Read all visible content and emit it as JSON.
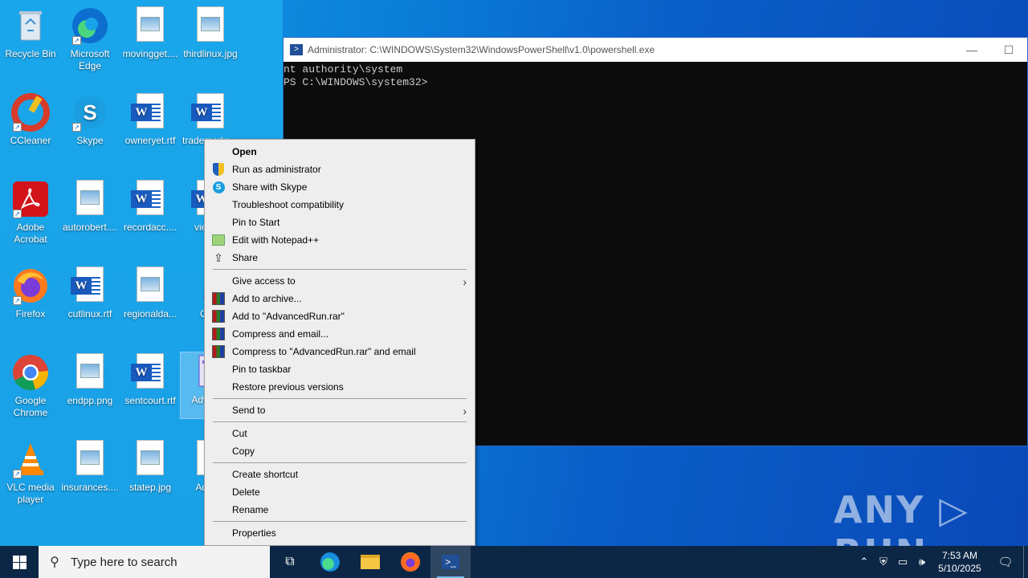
{
  "desktop": {
    "icons": [
      {
        "label": "Recycle Bin"
      },
      {
        "label": "Microsoft Edge"
      },
      {
        "label": "movingget...."
      },
      {
        "label": "thirdlinux.jpg"
      },
      {
        "label": "CCleaner"
      },
      {
        "label": "Skype"
      },
      {
        "label": "owneryet.rtf"
      },
      {
        "label": "trademarks..."
      },
      {
        "label": "Adobe Acrobat"
      },
      {
        "label": "autorobert...."
      },
      {
        "label": "recordacc...."
      },
      {
        "label": "views..."
      },
      {
        "label": "Firefox"
      },
      {
        "label": "cutlinux.rtf"
      },
      {
        "label": "regionalda..."
      },
      {
        "label": "Oh..."
      },
      {
        "label": "Google Chrome"
      },
      {
        "label": "endpp.png"
      },
      {
        "label": "sentcourt.rtf"
      },
      {
        "label": "Adva... n"
      },
      {
        "label": "VLC media player"
      },
      {
        "label": "insurances...."
      },
      {
        "label": "statep.jpg"
      },
      {
        "label": "Adva..."
      }
    ]
  },
  "powershell": {
    "title": "Administrator: C:\\WINDOWS\\System32\\WindowsPowerShell\\v1.0\\powershell.exe",
    "lines": [
      "nt authority\\system",
      "PS C:\\WINDOWS\\system32>"
    ],
    "minimize": "—",
    "maximize": "☐"
  },
  "context_menu": {
    "items": [
      {
        "label": "Open",
        "icon": ""
      },
      {
        "label": "Run as administrator",
        "icon": "shield-icon"
      },
      {
        "label": "Share with Skype",
        "icon": "skype-icon"
      },
      {
        "label": "Troubleshoot compatibility",
        "icon": ""
      },
      {
        "label": "Pin to Start",
        "icon": ""
      },
      {
        "label": "Edit with Notepad++",
        "icon": "notepadpp-icon"
      },
      {
        "label": "Share",
        "icon": "share-icon"
      },
      {
        "label": "Give access to",
        "icon": "",
        "submenu": true
      },
      {
        "label": "Add to archive...",
        "icon": "winrar-icon"
      },
      {
        "label": "Add to \"AdvancedRun.rar\"",
        "icon": "winrar-icon"
      },
      {
        "label": "Compress and email...",
        "icon": "winrar-icon"
      },
      {
        "label": "Compress to \"AdvancedRun.rar\" and email",
        "icon": "winrar-icon"
      },
      {
        "label": "Pin to taskbar",
        "icon": ""
      },
      {
        "label": "Restore previous versions",
        "icon": ""
      },
      {
        "label": "Send to",
        "icon": "",
        "submenu": true
      },
      {
        "label": "Cut",
        "icon": ""
      },
      {
        "label": "Copy",
        "icon": ""
      },
      {
        "label": "Create shortcut",
        "icon": ""
      },
      {
        "label": "Delete",
        "icon": ""
      },
      {
        "label": "Rename",
        "icon": ""
      },
      {
        "label": "Properties",
        "icon": ""
      }
    ]
  },
  "taskbar": {
    "search_placeholder": "Type here to search",
    "clock_time": "7:53 AM",
    "clock_date": "5/10/2025"
  },
  "watermark": "ANY ▷ RUN",
  "colors": {
    "taskbar": "#0c2746",
    "menu_bg": "#eeeeee",
    "console_bg": "#0c0c0c"
  }
}
